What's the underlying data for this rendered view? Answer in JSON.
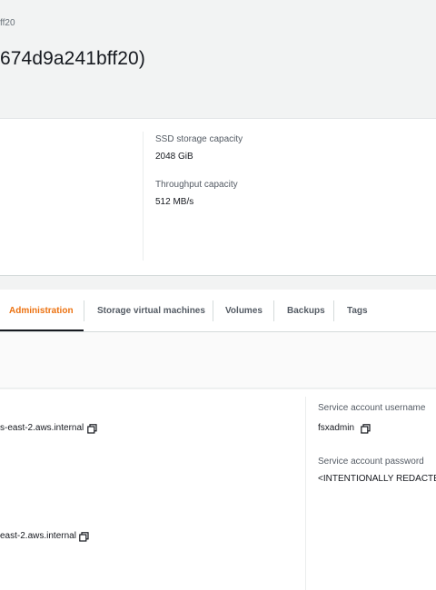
{
  "breadcrumb": "ff20",
  "title": "674d9a241bff20)",
  "summary": {
    "ssd_label": "SSD storage capacity",
    "ssd_value": "2048 GiB",
    "throughput_label": "Throughput capacity",
    "throughput_value": "512 MB/s"
  },
  "tabs": [
    {
      "label": "Administration",
      "active": true
    },
    {
      "label": "Storage virtual machines",
      "active": false
    },
    {
      "label": "Volumes",
      "active": false
    },
    {
      "label": "Backups",
      "active": false
    },
    {
      "label": "Tags",
      "active": false
    }
  ],
  "admin": {
    "dns_name_1": "s-east-2.aws.internal",
    "dns_name_2": "east-2.aws.internal",
    "svc_user_label": "Service account username",
    "svc_user_value": "fsxadmin",
    "svc_pass_label": "Service account password",
    "svc_pass_value": "<INTENTIONALLY REDACTED>"
  },
  "icons": {
    "copy": "copy-icon"
  },
  "colors": {
    "accent": "#ec7211",
    "text": "#16191f",
    "muted": "#545b64"
  }
}
